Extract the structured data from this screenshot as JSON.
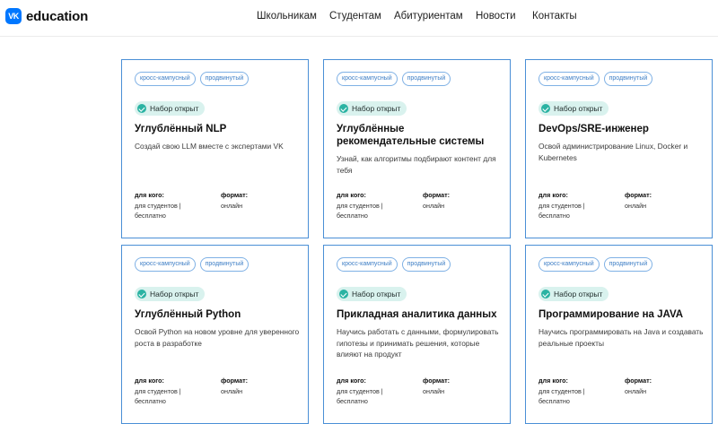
{
  "header": {
    "logo_mark": "VK",
    "logo_text": "education",
    "nav": [
      "Школьникам",
      "Студентам",
      "Абитуриентам",
      "Новости",
      "Контакты"
    ]
  },
  "cards": [
    {
      "tags": [
        "кросс-кампусный",
        "продвинутый"
      ],
      "status": "Набор открыт",
      "title": "Углублённый NLP",
      "description": "Создай свою LLM вместе с экспертами VK",
      "audience_label": "для кого:",
      "audience_value": "для студентов | бесплатно",
      "format_label": "формат:",
      "format_value": "онлайн"
    },
    {
      "tags": [
        "кросс-кампусный",
        "продвинутый"
      ],
      "status": "Набор открыт",
      "title": "Углублённые рекомендательные системы",
      "description": "Узнай, как алгоритмы подбирают контент для тебя",
      "audience_label": "для кого:",
      "audience_value": "для студентов | бесплатно",
      "format_label": "формат:",
      "format_value": "онлайн"
    },
    {
      "tags": [
        "кросс-кампусный",
        "продвинутый"
      ],
      "status": "Набор открыт",
      "title": "DevOps/SRE-инженер",
      "description": "Освой администрирование Linux, Docker и Kubernetes",
      "audience_label": "для кого:",
      "audience_value": "для студентов | бесплатно",
      "format_label": "формат:",
      "format_value": "онлайн"
    },
    {
      "tags": [
        "кросс-кампусный",
        "продвинутый"
      ],
      "status": "Набор открыт",
      "title": "Углублённый Python",
      "description": "Освой Python на новом уровне для уверенного роста в разработке",
      "audience_label": "для кого:",
      "audience_value": "для студентов | бесплатно",
      "format_label": "формат:",
      "format_value": "онлайн"
    },
    {
      "tags": [
        "кросс-кампусный",
        "продвинутый"
      ],
      "status": "Набор открыт",
      "title": "Прикладная аналитика данных",
      "description": "Научись работать с данными, формулировать гипотезы и принимать решения, которые влияют на продукт",
      "audience_label": "для кого:",
      "audience_value": "для студентов | бесплатно",
      "format_label": "формат:",
      "format_value": "онлайн"
    },
    {
      "tags": [
        "кросс-кампусный",
        "продвинутый"
      ],
      "status": "Набор открыт",
      "title": "Программирование на JAVA",
      "description": "Научись программировать на Java и создавать реальные проекты",
      "audience_label": "для кого:",
      "audience_value": "для студентов | бесплатно",
      "format_label": "формат:",
      "format_value": "онлайн"
    }
  ],
  "colors": {
    "brand": "#0077ff",
    "card_border": "#4a8fd6",
    "tag": "#3f7fc6",
    "status_bg": "#d9f2ee",
    "status_check": "#2bb3a3"
  }
}
